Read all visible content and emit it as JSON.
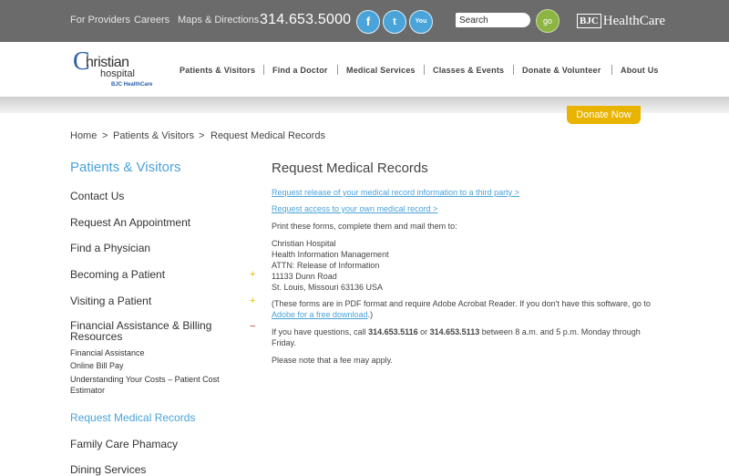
{
  "topbar": {
    "links": [
      "For Providers",
      "Careers",
      "Maps & Directions"
    ],
    "phone": "314.653.5000",
    "social": [
      "f",
      "t",
      "You"
    ],
    "search_placeholder": "Search",
    "go_label": "go",
    "bjc_box": "BJC",
    "bjc_text": "HealthCare"
  },
  "logo": {
    "c": "C",
    "line1": "hristian",
    "line2": "hospital",
    "line3": "BJC HealthCare"
  },
  "nav": [
    "Patients & Visitors",
    "Find a Doctor",
    "Medical Services",
    "Classes & Events",
    "Donate & Volunteer",
    "About Us"
  ],
  "donate_label": "Donate Now",
  "breadcrumb": {
    "home": "Home",
    "sep": ">",
    "level2": "Patients & Visitors",
    "current": "Request Medical Records"
  },
  "sidebar": {
    "title": "Patients & Visitors",
    "items": [
      "Contact Us",
      "Request An Appointment",
      "Find a Physician",
      "Becoming a Patient",
      "Visiting a Patient",
      "Financial Assistance & Billing Resources",
      "Request Medical Records",
      "Family Care Phamacy",
      "Dining Services"
    ],
    "plus": "+",
    "minus": "−",
    "subitems": [
      "Financial Assistance",
      "Online Bill Pay",
      "Understanding Your Costs – Patient Cost Estimator"
    ]
  },
  "main": {
    "title": "Request Medical Records",
    "link1": "Request release of your medical record information to a third party >",
    "link2": "Request access to your own medical record >",
    "intro": "Print these forms, complete them and mail them to:",
    "address": [
      "Christian Hospital",
      "Health Information Management",
      "ATTN: Release of Information",
      "11133 Dunn Road",
      "St. Louis, Missouri 63136 USA"
    ],
    "pdf_note_pre": "(These forms are in PDF format and require Adobe Acrobat Reader. If you don't have this software, go to ",
    "pdf_link": "Adobe for a free download",
    "pdf_note_post": ".)",
    "questions_pre": "If you have questions, call ",
    "phone1": "314.653.5116",
    "questions_mid": " or ",
    "phone2": "314.653.5113",
    "questions_post": " between 8 a.m. and 5 p.m. Monday through Friday.",
    "fee": "Please note that a fee may apply."
  }
}
